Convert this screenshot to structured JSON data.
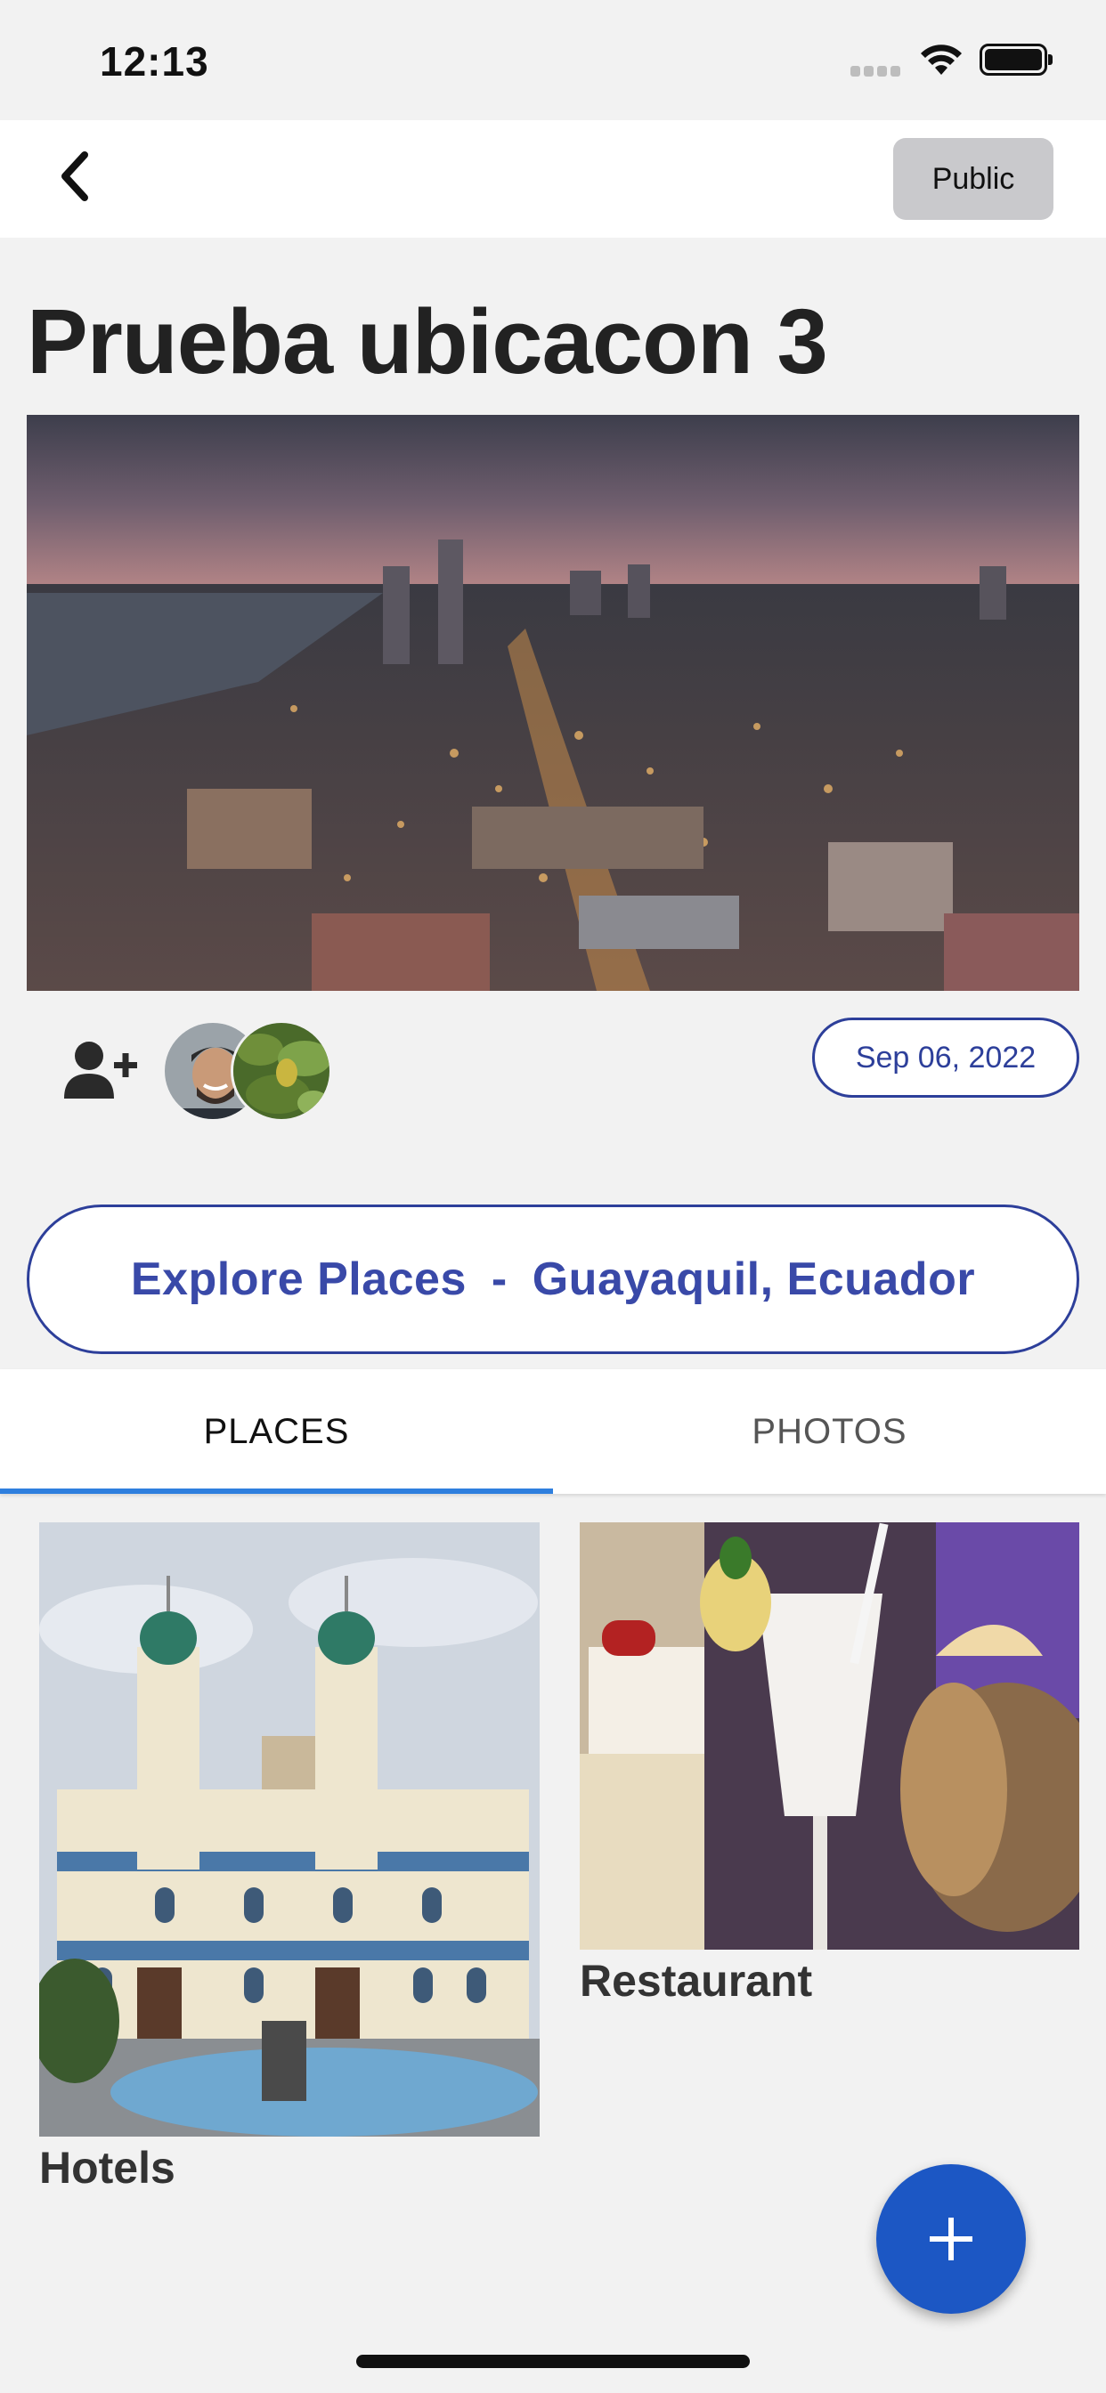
{
  "status_bar": {
    "time": "12:13",
    "icons": [
      "signal-icon",
      "wifi-icon",
      "battery-icon"
    ]
  },
  "nav": {
    "back_icon": "chevron-left-icon",
    "public_label": "Public"
  },
  "trip": {
    "title": "Prueba ubicacon 3",
    "date": "Sep 06, 2022",
    "add_person_icon": "user-plus-icon",
    "members": [
      "avatar-smiling-man",
      "avatar-tree-leaves"
    ]
  },
  "explore": {
    "prefix": "Explore Places",
    "separator": "-",
    "location": "Guayaquil, Ecuador"
  },
  "tabs": [
    {
      "label": "PLACES",
      "active": true
    },
    {
      "label": "PHOTOS",
      "active": false
    }
  ],
  "places": [
    {
      "label": "Hotels"
    },
    {
      "label": "Restaurant"
    }
  ],
  "fab": {
    "icon": "plus-icon"
  },
  "colors": {
    "accent": "#3949a8",
    "tab_indicator": "#2f7fde",
    "fab": "#1c57c4",
    "background": "#f2f2f2"
  }
}
